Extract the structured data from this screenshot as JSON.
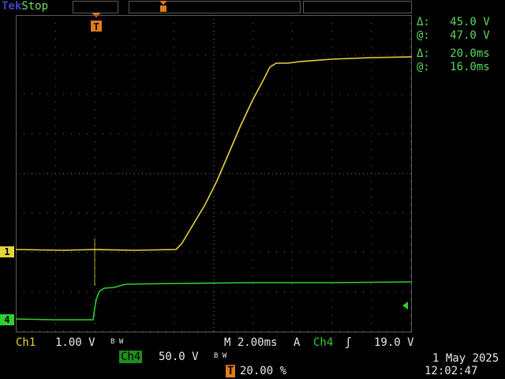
{
  "header": {
    "brand_tek": "Tek",
    "acq_state": "Stop"
  },
  "channels": {
    "ch1_marker": "1",
    "ch4_marker": "4"
  },
  "cursors": {
    "delta_v": "Δ:   45.0 V",
    "at_v": "@:   47.0 V",
    "delta_t": "Δ:   20.0ms",
    "at_t": "@:   16.0ms"
  },
  "status": {
    "ch1_label": "Ch1",
    "ch1_scale": "1.00 V",
    "bw_label": "B W",
    "timebase": "M 2.00ms",
    "trigger_mode": "A",
    "trigger_source": "Ch4",
    "trigger_slope": "ʃ",
    "trigger_level": "19.0 V",
    "ch4_label": "Ch4",
    "ch4_scale": "50.0 V",
    "trig_pos_T": "T",
    "trig_pos": "20.00 %",
    "date": "1 May 2025",
    "time": "12:02:47"
  },
  "colors": {
    "ch1": "#e6d23a",
    "ch4": "#2fd02f",
    "grid": "#5a5a5a",
    "trigger": "#e07a20"
  }
}
